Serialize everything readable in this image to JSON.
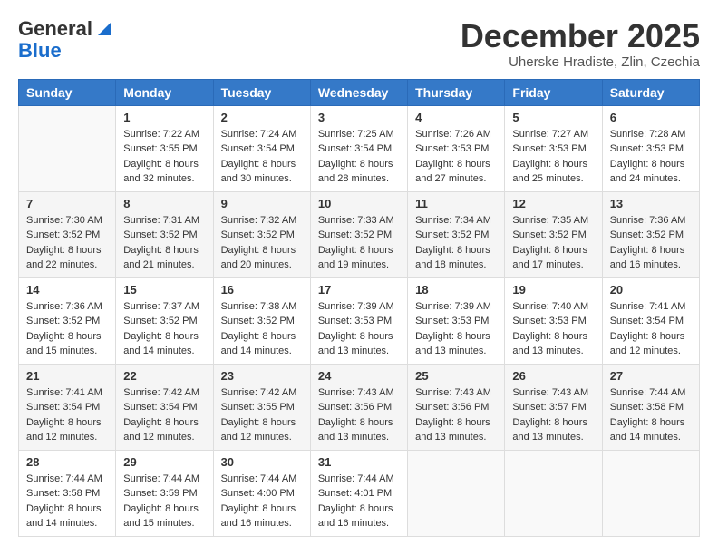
{
  "logo": {
    "general": "General",
    "blue": "Blue",
    "tagline": "Blue"
  },
  "header": {
    "month": "December 2025",
    "location": "Uherske Hradiste, Zlin, Czechia"
  },
  "weekdays": [
    "Sunday",
    "Monday",
    "Tuesday",
    "Wednesday",
    "Thursday",
    "Friday",
    "Saturday"
  ],
  "weeks": [
    [
      {
        "day": "",
        "sunrise": "",
        "sunset": "",
        "daylight": ""
      },
      {
        "day": "1",
        "sunrise": "Sunrise: 7:22 AM",
        "sunset": "Sunset: 3:55 PM",
        "daylight": "Daylight: 8 hours and 32 minutes."
      },
      {
        "day": "2",
        "sunrise": "Sunrise: 7:24 AM",
        "sunset": "Sunset: 3:54 PM",
        "daylight": "Daylight: 8 hours and 30 minutes."
      },
      {
        "day": "3",
        "sunrise": "Sunrise: 7:25 AM",
        "sunset": "Sunset: 3:54 PM",
        "daylight": "Daylight: 8 hours and 28 minutes."
      },
      {
        "day": "4",
        "sunrise": "Sunrise: 7:26 AM",
        "sunset": "Sunset: 3:53 PM",
        "daylight": "Daylight: 8 hours and 27 minutes."
      },
      {
        "day": "5",
        "sunrise": "Sunrise: 7:27 AM",
        "sunset": "Sunset: 3:53 PM",
        "daylight": "Daylight: 8 hours and 25 minutes."
      },
      {
        "day": "6",
        "sunrise": "Sunrise: 7:28 AM",
        "sunset": "Sunset: 3:53 PM",
        "daylight": "Daylight: 8 hours and 24 minutes."
      }
    ],
    [
      {
        "day": "7",
        "sunrise": "Sunrise: 7:30 AM",
        "sunset": "Sunset: 3:52 PM",
        "daylight": "Daylight: 8 hours and 22 minutes."
      },
      {
        "day": "8",
        "sunrise": "Sunrise: 7:31 AM",
        "sunset": "Sunset: 3:52 PM",
        "daylight": "Daylight: 8 hours and 21 minutes."
      },
      {
        "day": "9",
        "sunrise": "Sunrise: 7:32 AM",
        "sunset": "Sunset: 3:52 PM",
        "daylight": "Daylight: 8 hours and 20 minutes."
      },
      {
        "day": "10",
        "sunrise": "Sunrise: 7:33 AM",
        "sunset": "Sunset: 3:52 PM",
        "daylight": "Daylight: 8 hours and 19 minutes."
      },
      {
        "day": "11",
        "sunrise": "Sunrise: 7:34 AM",
        "sunset": "Sunset: 3:52 PM",
        "daylight": "Daylight: 8 hours and 18 minutes."
      },
      {
        "day": "12",
        "sunrise": "Sunrise: 7:35 AM",
        "sunset": "Sunset: 3:52 PM",
        "daylight": "Daylight: 8 hours and 17 minutes."
      },
      {
        "day": "13",
        "sunrise": "Sunrise: 7:36 AM",
        "sunset": "Sunset: 3:52 PM",
        "daylight": "Daylight: 8 hours and 16 minutes."
      }
    ],
    [
      {
        "day": "14",
        "sunrise": "Sunrise: 7:36 AM",
        "sunset": "Sunset: 3:52 PM",
        "daylight": "Daylight: 8 hours and 15 minutes."
      },
      {
        "day": "15",
        "sunrise": "Sunrise: 7:37 AM",
        "sunset": "Sunset: 3:52 PM",
        "daylight": "Daylight: 8 hours and 14 minutes."
      },
      {
        "day": "16",
        "sunrise": "Sunrise: 7:38 AM",
        "sunset": "Sunset: 3:52 PM",
        "daylight": "Daylight: 8 hours and 14 minutes."
      },
      {
        "day": "17",
        "sunrise": "Sunrise: 7:39 AM",
        "sunset": "Sunset: 3:53 PM",
        "daylight": "Daylight: 8 hours and 13 minutes."
      },
      {
        "day": "18",
        "sunrise": "Sunrise: 7:39 AM",
        "sunset": "Sunset: 3:53 PM",
        "daylight": "Daylight: 8 hours and 13 minutes."
      },
      {
        "day": "19",
        "sunrise": "Sunrise: 7:40 AM",
        "sunset": "Sunset: 3:53 PM",
        "daylight": "Daylight: 8 hours and 13 minutes."
      },
      {
        "day": "20",
        "sunrise": "Sunrise: 7:41 AM",
        "sunset": "Sunset: 3:54 PM",
        "daylight": "Daylight: 8 hours and 12 minutes."
      }
    ],
    [
      {
        "day": "21",
        "sunrise": "Sunrise: 7:41 AM",
        "sunset": "Sunset: 3:54 PM",
        "daylight": "Daylight: 8 hours and 12 minutes."
      },
      {
        "day": "22",
        "sunrise": "Sunrise: 7:42 AM",
        "sunset": "Sunset: 3:54 PM",
        "daylight": "Daylight: 8 hours and 12 minutes."
      },
      {
        "day": "23",
        "sunrise": "Sunrise: 7:42 AM",
        "sunset": "Sunset: 3:55 PM",
        "daylight": "Daylight: 8 hours and 12 minutes."
      },
      {
        "day": "24",
        "sunrise": "Sunrise: 7:43 AM",
        "sunset": "Sunset: 3:56 PM",
        "daylight": "Daylight: 8 hours and 13 minutes."
      },
      {
        "day": "25",
        "sunrise": "Sunrise: 7:43 AM",
        "sunset": "Sunset: 3:56 PM",
        "daylight": "Daylight: 8 hours and 13 minutes."
      },
      {
        "day": "26",
        "sunrise": "Sunrise: 7:43 AM",
        "sunset": "Sunset: 3:57 PM",
        "daylight": "Daylight: 8 hours and 13 minutes."
      },
      {
        "day": "27",
        "sunrise": "Sunrise: 7:44 AM",
        "sunset": "Sunset: 3:58 PM",
        "daylight": "Daylight: 8 hours and 14 minutes."
      }
    ],
    [
      {
        "day": "28",
        "sunrise": "Sunrise: 7:44 AM",
        "sunset": "Sunset: 3:58 PM",
        "daylight": "Daylight: 8 hours and 14 minutes."
      },
      {
        "day": "29",
        "sunrise": "Sunrise: 7:44 AM",
        "sunset": "Sunset: 3:59 PM",
        "daylight": "Daylight: 8 hours and 15 minutes."
      },
      {
        "day": "30",
        "sunrise": "Sunrise: 7:44 AM",
        "sunset": "Sunset: 4:00 PM",
        "daylight": "Daylight: 8 hours and 16 minutes."
      },
      {
        "day": "31",
        "sunrise": "Sunrise: 7:44 AM",
        "sunset": "Sunset: 4:01 PM",
        "daylight": "Daylight: 8 hours and 16 minutes."
      },
      {
        "day": "",
        "sunrise": "",
        "sunset": "",
        "daylight": ""
      },
      {
        "day": "",
        "sunrise": "",
        "sunset": "",
        "daylight": ""
      },
      {
        "day": "",
        "sunrise": "",
        "sunset": "",
        "daylight": ""
      }
    ]
  ]
}
